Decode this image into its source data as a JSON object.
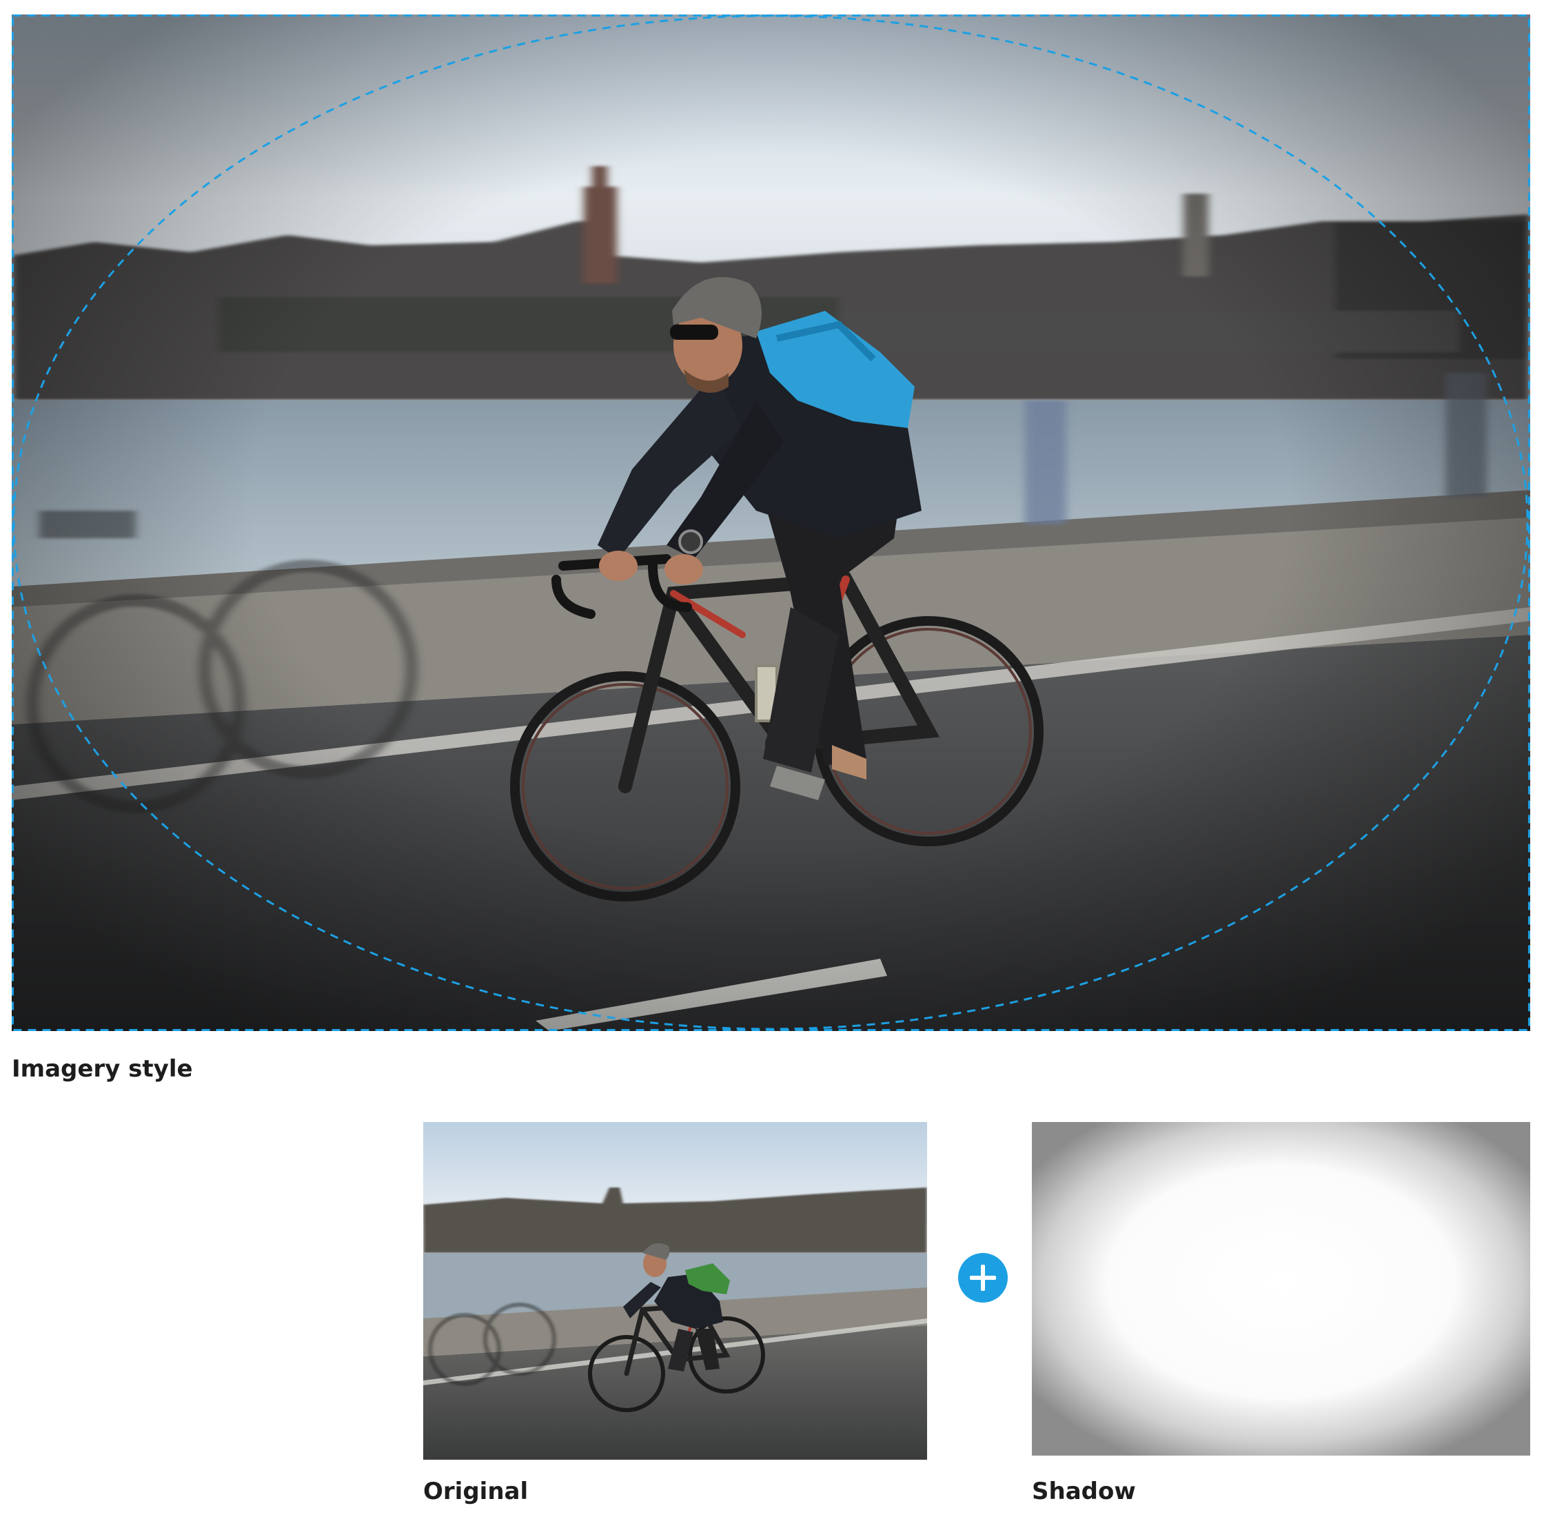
{
  "captions": {
    "imagery_style": "Imagery style",
    "original": "Original",
    "shadow": "Shadow"
  },
  "icons": {
    "combine": "plus-icon"
  },
  "colors": {
    "accent": "#1da0e3",
    "backpack_hero": "#2d9fd6",
    "backpack_original": "#3f8f3d",
    "caption_text": "#1d1d1d"
  }
}
